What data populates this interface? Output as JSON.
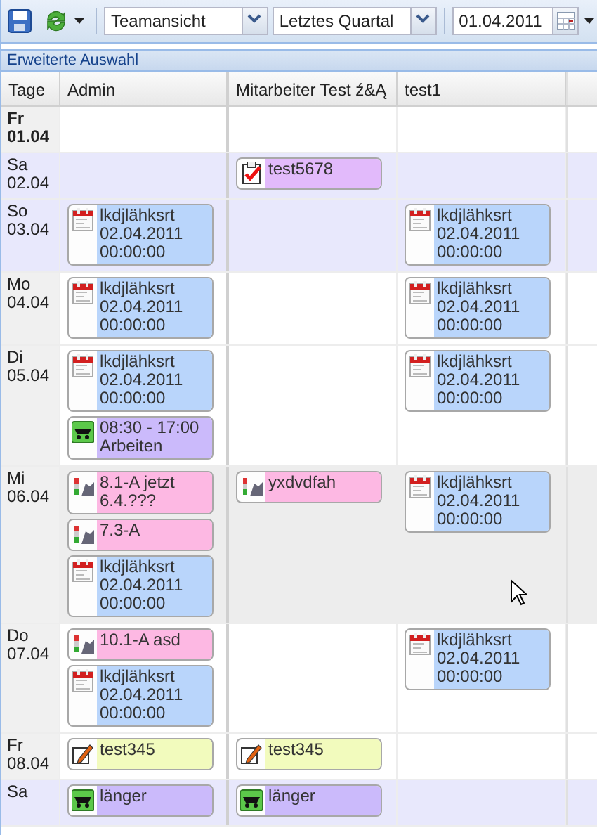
{
  "toolbar": {
    "view": "Teamansicht",
    "period": "Letztes Quartal",
    "date": "01.04.2011"
  },
  "panel": {
    "title": "Erweiterte Auswahl"
  },
  "columns": [
    "Tage",
    "Admin",
    "Mitarbeiter Test ź&Ą",
    "test1"
  ],
  "rows": [
    {
      "day": "Fr",
      "date": "01.04",
      "current": true,
      "weekend": false,
      "hovered": false,
      "cells": [
        [],
        [],
        []
      ]
    },
    {
      "day": "Sa",
      "date": "02.04",
      "current": false,
      "weekend": true,
      "hovered": false,
      "cells": [
        [],
        [
          {
            "kind": "task",
            "color": "#e2bafb",
            "text": "test5678"
          }
        ],
        []
      ]
    },
    {
      "day": "So",
      "date": "03.04",
      "current": false,
      "weekend": true,
      "hovered": false,
      "cells": [
        [
          {
            "kind": "appointment",
            "color": "#b9d5fb",
            "text": "lkdjlähksrt 02.04.2011 00:00:00"
          }
        ],
        [],
        [
          {
            "kind": "appointment",
            "color": "#b9d5fb",
            "text": "lkdjlähksrt 02.04.2011 00:00:00"
          }
        ]
      ]
    },
    {
      "day": "Mo",
      "date": "04.04",
      "current": false,
      "weekend": false,
      "hovered": false,
      "cells": [
        [
          {
            "kind": "appointment",
            "color": "#b9d5fb",
            "text": "lkdjlähksrt 02.04.2011 00:00:00"
          }
        ],
        [],
        [
          {
            "kind": "appointment",
            "color": "#b9d5fb",
            "text": "lkdjlähksrt 02.04.2011 00:00:00"
          }
        ]
      ]
    },
    {
      "day": "Di",
      "date": "05.04",
      "current": false,
      "weekend": false,
      "hovered": false,
      "cells": [
        [
          {
            "kind": "appointment",
            "color": "#b9d5fb",
            "text": "lkdjlähksrt 02.04.2011 00:00:00"
          },
          {
            "kind": "shift",
            "color": "#cbbafb",
            "text": "08:30 - 17:00 Arbeiten"
          }
        ],
        [],
        [
          {
            "kind": "appointment",
            "color": "#b9d5fb",
            "text": "lkdjlähksrt 02.04.2011 00:00:00"
          }
        ]
      ]
    },
    {
      "day": "Mi",
      "date": "06.04",
      "current": false,
      "weekend": false,
      "hovered": true,
      "cells": [
        [
          {
            "kind": "ticket",
            "color": "#fdb8e3",
            "text": "8.1-A jetzt 6.4.???"
          },
          {
            "kind": "ticket",
            "color": "#fdb8e3",
            "text": "7.3-A"
          },
          {
            "kind": "appointment",
            "color": "#b9d5fb",
            "text": "lkdjlähksrt 02.04.2011 00:00:00"
          }
        ],
        [
          {
            "kind": "ticket",
            "color": "#fdb8e3",
            "text": "yxdvdfah"
          }
        ],
        [
          {
            "kind": "appointment",
            "color": "#b9d5fb",
            "text": "lkdjlähksrt 02.04.2011 00:00:00"
          }
        ]
      ]
    },
    {
      "day": "Do",
      "date": "07.04",
      "current": false,
      "weekend": false,
      "hovered": false,
      "cells": [
        [
          {
            "kind": "ticket",
            "color": "#fdb8e3",
            "text": "10.1-A asd"
          },
          {
            "kind": "appointment",
            "color": "#b9d5fb",
            "text": "lkdjlähksrt 02.04.2011 00:00:00"
          }
        ],
        [],
        [
          {
            "kind": "appointment",
            "color": "#b9d5fb",
            "text": "lkdjlähksrt 02.04.2011 00:00:00"
          }
        ]
      ]
    },
    {
      "day": "Fr",
      "date": "08.04",
      "current": false,
      "weekend": false,
      "hovered": false,
      "cells": [
        [
          {
            "kind": "note",
            "color": "#f2fbbd",
            "text": "test345"
          }
        ],
        [
          {
            "kind": "note",
            "color": "#f2fbbd",
            "text": "test345"
          }
        ],
        []
      ]
    },
    {
      "day": "Sa",
      "current": false,
      "weekend": true,
      "hovered": false,
      "cells": [
        [
          {
            "kind": "shift",
            "color": "#cbbafb",
            "text": "länger"
          }
        ],
        [
          {
            "kind": "shift",
            "color": "#cbbafb",
            "text": "länger"
          }
        ],
        []
      ]
    }
  ]
}
